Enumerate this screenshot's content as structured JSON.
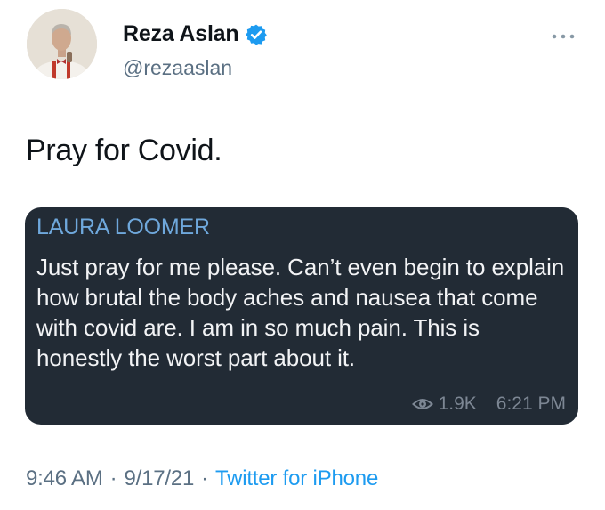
{
  "author": {
    "display_name": "Reza Aslan",
    "handle": "@rezaaslan",
    "verified": true,
    "avatar": "avatar-photo"
  },
  "tweet": {
    "text": "Pray for Covid."
  },
  "quoted_message": {
    "author": "LAURA LOOMER",
    "body": "Just pray for me please. Can’t even begin to explain how brutal the body aches and nausea that come with covid are. I am in so much pain. This is honestly the worst part about it.",
    "views": "1.9K",
    "time": "6:21 PM",
    "views_icon": "eye-icon"
  },
  "footer": {
    "time": "9:46 AM",
    "date": "9/17/21",
    "separator": "·",
    "source": "Twitter for iPhone"
  },
  "colors": {
    "verified_badge": "#1d9bf0",
    "link": "#1d9bf0",
    "secondary_text": "#5b7083",
    "card_background": "#222b35",
    "card_author": "#6fa8dc"
  },
  "icons": [
    "verified-badge-icon",
    "more-options-icon",
    "eye-icon"
  ]
}
